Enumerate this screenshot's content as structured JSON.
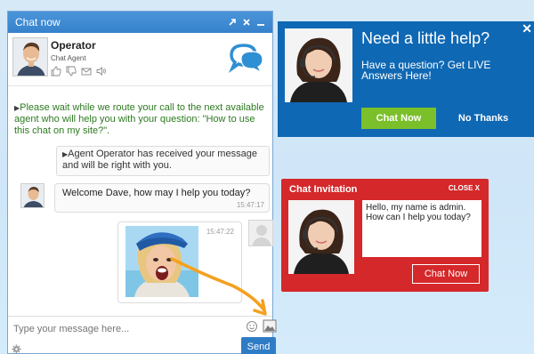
{
  "chat": {
    "title": "Chat now",
    "header_buttons": [
      "expand-icon",
      "close-icon",
      "minimize-icon"
    ],
    "operator": {
      "name": "Operator",
      "role": "Chat Agent"
    },
    "system_message": "Please wait while we route your call to the next available agent who will help you with your question: \"How to use this chat on my site?\".",
    "note_message": "Agent Operator has received your message and will be right with you.",
    "operator_message": {
      "text": "Welcome Dave, how may I help you today?",
      "time": "15:47:17"
    },
    "user_message": {
      "time": "15:47:22"
    },
    "compose": {
      "placeholder": "Type your message here..."
    },
    "send_label": "Send"
  },
  "help_panel": {
    "heading": "Need a little help?",
    "subtext": "Have a question? Get LIVE Answers Here!",
    "chat_now": "Chat Now",
    "no_thanks": "No Thanks",
    "close_symbol": "✕"
  },
  "invitation": {
    "title": "Chat Invitation",
    "close_label": "CLOSE X",
    "message": "Hello, my name is admin. How can I help you today?",
    "button": "Chat Now"
  },
  "colors": {
    "chat_header": "#3c87cf",
    "help_bg": "#0f68b3",
    "invite_bg": "#d5282a",
    "system_text": "#2c7a1f",
    "chat_now_green": "#7bc02a",
    "arrow": "#f4a020"
  }
}
